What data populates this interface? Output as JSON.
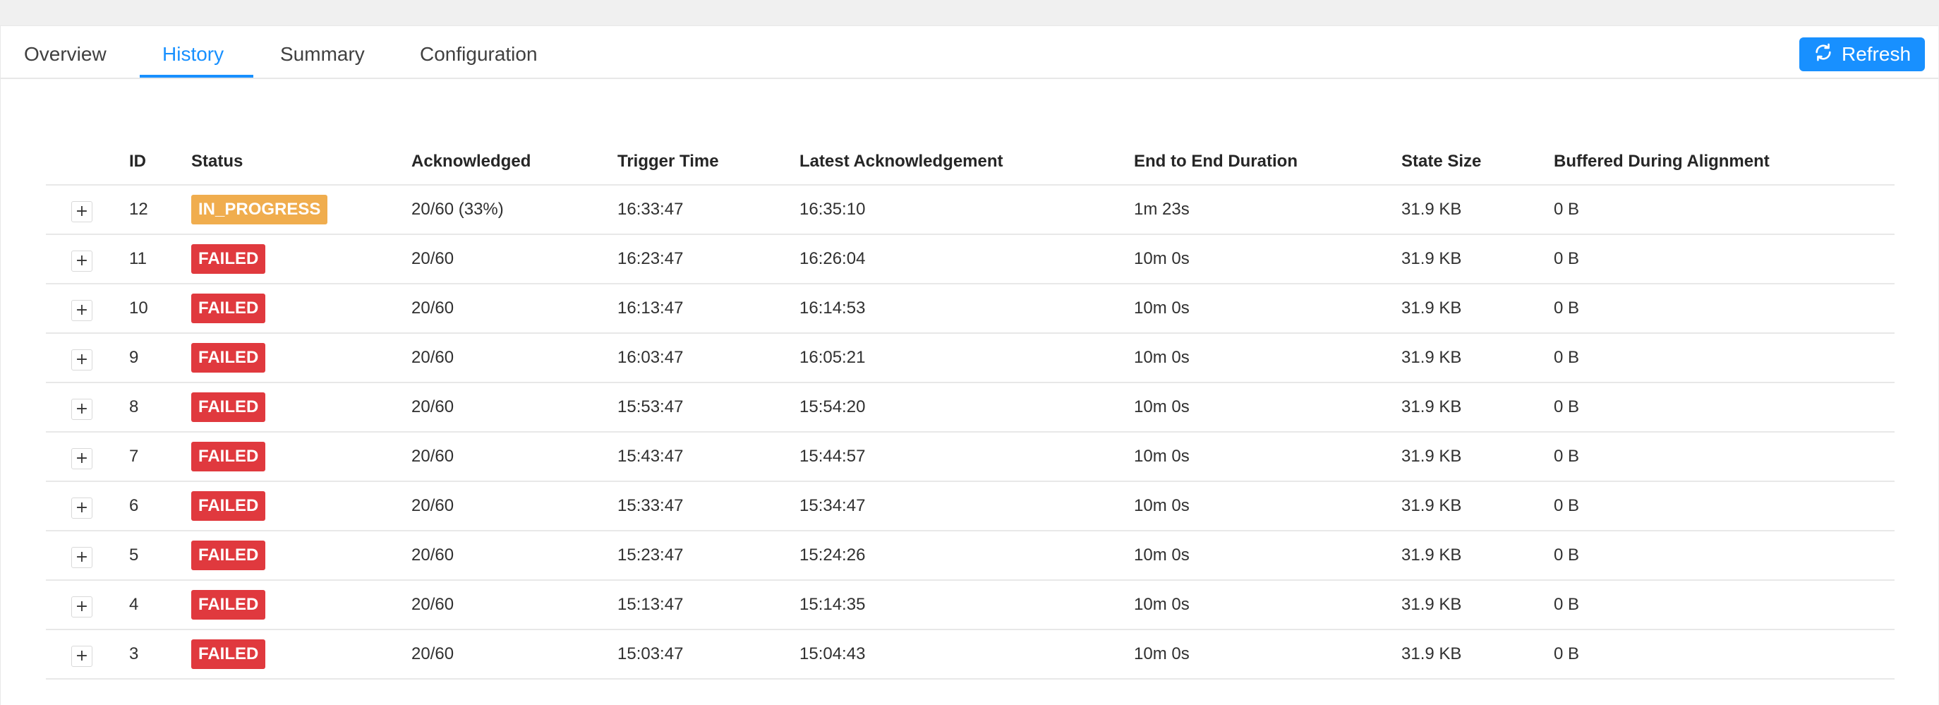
{
  "tabs": [
    {
      "label": "Overview",
      "active": false
    },
    {
      "label": "History",
      "active": true
    },
    {
      "label": "Summary",
      "active": false
    },
    {
      "label": "Configuration",
      "active": false
    }
  ],
  "refresh_button": {
    "label": "Refresh",
    "icon": "refresh-icon"
  },
  "colors": {
    "accent": "#1890ff",
    "in_progress": "#f0ad4e",
    "failed": "#e0393e"
  },
  "table": {
    "headers": {
      "id": "ID",
      "status": "Status",
      "acknowledged": "Acknowledged",
      "trigger_time": "Trigger Time",
      "latest_ack": "Latest Acknowledgement",
      "duration": "End to End Duration",
      "state_size": "State Size",
      "buffered": "Buffered During Alignment"
    },
    "rows": [
      {
        "expand": "+",
        "id": "12",
        "status": "IN_PROGRESS",
        "acknowledged": "20/60 (33%)",
        "trigger_time": "16:33:47",
        "latest_ack": "16:35:10",
        "duration": "1m 23s",
        "state_size": "31.9 KB",
        "buffered": "0 B"
      },
      {
        "expand": "+",
        "id": "11",
        "status": "FAILED",
        "acknowledged": "20/60",
        "trigger_time": "16:23:47",
        "latest_ack": "16:26:04",
        "duration": "10m 0s",
        "state_size": "31.9 KB",
        "buffered": "0 B"
      },
      {
        "expand": "+",
        "id": "10",
        "status": "FAILED",
        "acknowledged": "20/60",
        "trigger_time": "16:13:47",
        "latest_ack": "16:14:53",
        "duration": "10m 0s",
        "state_size": "31.9 KB",
        "buffered": "0 B"
      },
      {
        "expand": "+",
        "id": "9",
        "status": "FAILED",
        "acknowledged": "20/60",
        "trigger_time": "16:03:47",
        "latest_ack": "16:05:21",
        "duration": "10m 0s",
        "state_size": "31.9 KB",
        "buffered": "0 B"
      },
      {
        "expand": "+",
        "id": "8",
        "status": "FAILED",
        "acknowledged": "20/60",
        "trigger_time": "15:53:47",
        "latest_ack": "15:54:20",
        "duration": "10m 0s",
        "state_size": "31.9 KB",
        "buffered": "0 B"
      },
      {
        "expand": "+",
        "id": "7",
        "status": "FAILED",
        "acknowledged": "20/60",
        "trigger_time": "15:43:47",
        "latest_ack": "15:44:57",
        "duration": "10m 0s",
        "state_size": "31.9 KB",
        "buffered": "0 B"
      },
      {
        "expand": "+",
        "id": "6",
        "status": "FAILED",
        "acknowledged": "20/60",
        "trigger_time": "15:33:47",
        "latest_ack": "15:34:47",
        "duration": "10m 0s",
        "state_size": "31.9 KB",
        "buffered": "0 B"
      },
      {
        "expand": "+",
        "id": "5",
        "status": "FAILED",
        "acknowledged": "20/60",
        "trigger_time": "15:23:47",
        "latest_ack": "15:24:26",
        "duration": "10m 0s",
        "state_size": "31.9 KB",
        "buffered": "0 B"
      },
      {
        "expand": "+",
        "id": "4",
        "status": "FAILED",
        "acknowledged": "20/60",
        "trigger_time": "15:13:47",
        "latest_ack": "15:14:35",
        "duration": "10m 0s",
        "state_size": "31.9 KB",
        "buffered": "0 B"
      },
      {
        "expand": "+",
        "id": "3",
        "status": "FAILED",
        "acknowledged": "20/60",
        "trigger_time": "15:03:47",
        "latest_ack": "15:04:43",
        "duration": "10m 0s",
        "state_size": "31.9 KB",
        "buffered": "0 B"
      }
    ]
  }
}
